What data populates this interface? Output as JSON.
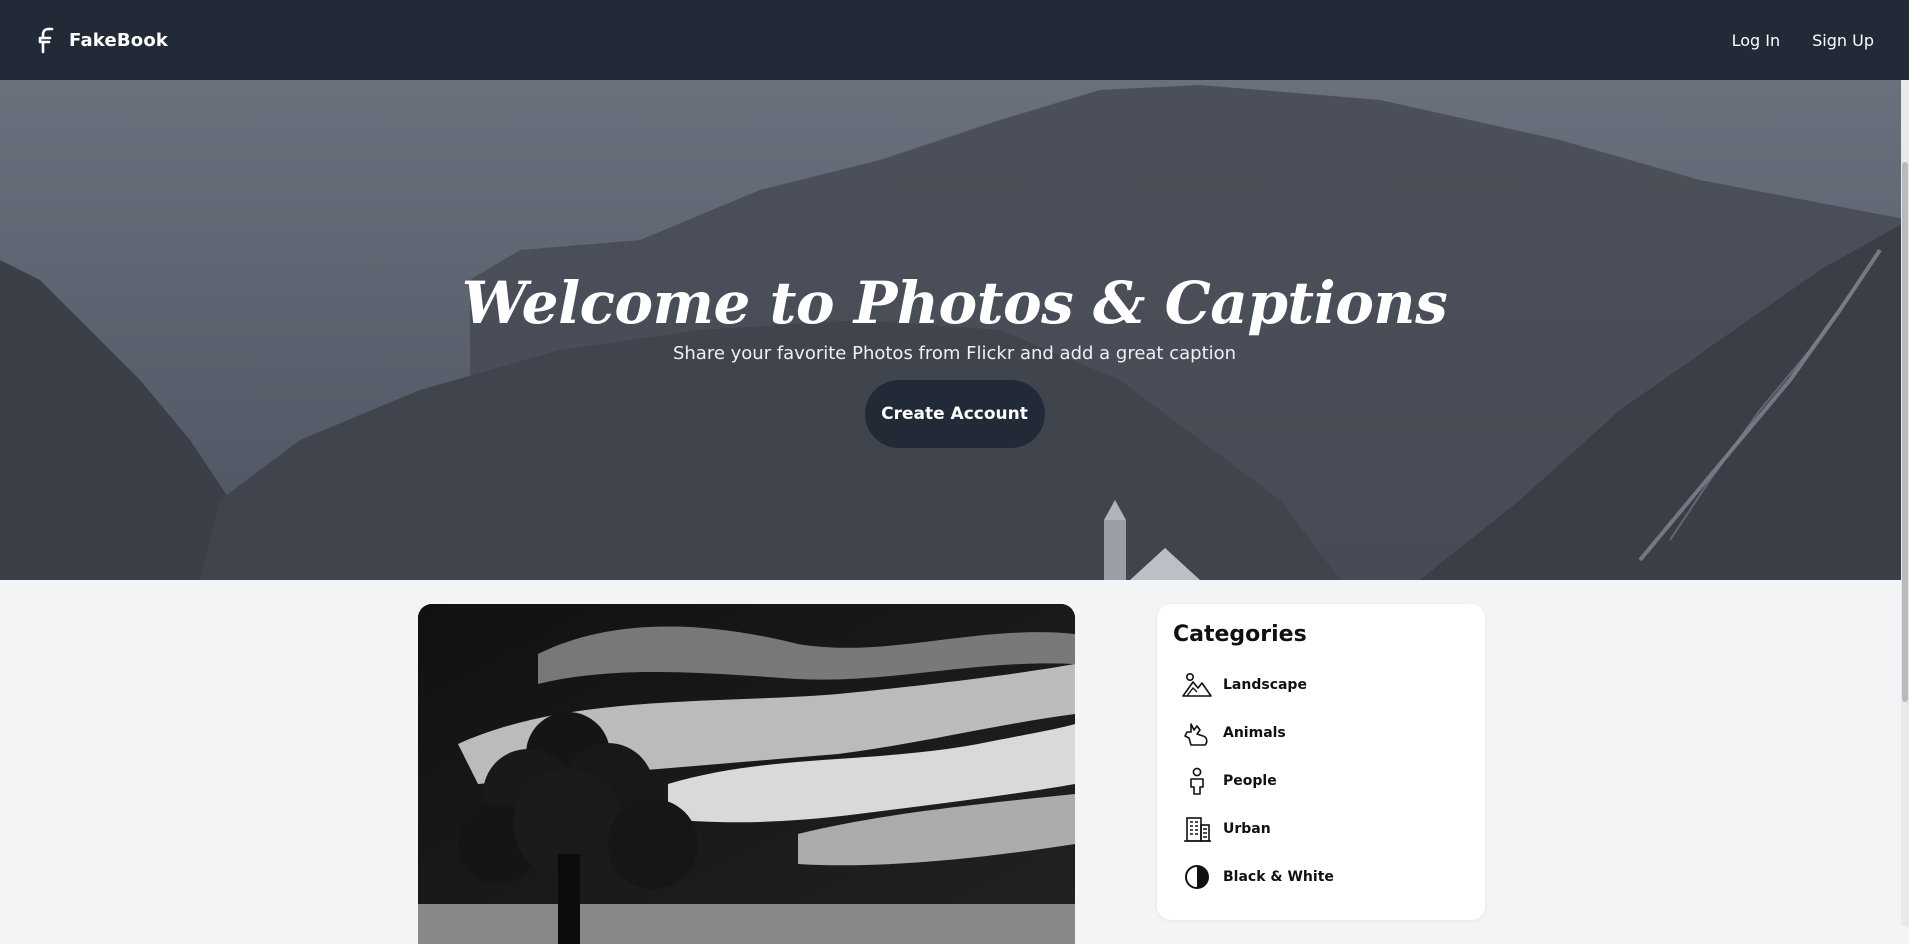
{
  "navbar": {
    "brand_name": "FakeBook",
    "login_label": "Log In",
    "signup_label": "Sign Up"
  },
  "hero": {
    "title": "Welcome to Photos & Captions",
    "subtitle": "Share your favorite Photos from Flickr and add a great caption",
    "cta_label": "Create Account"
  },
  "categories": {
    "title": "Categories",
    "items": [
      {
        "label": "Landscape",
        "icon": "landscape-icon"
      },
      {
        "label": "Animals",
        "icon": "animals-icon"
      },
      {
        "label": "People",
        "icon": "people-icon"
      },
      {
        "label": "Urban",
        "icon": "urban-icon"
      },
      {
        "label": "Black & White",
        "icon": "black-white-icon"
      }
    ]
  },
  "colors": {
    "navbar_bg": "#222a38",
    "page_bg": "#f3f4f6",
    "button_bg": "#222a38"
  }
}
